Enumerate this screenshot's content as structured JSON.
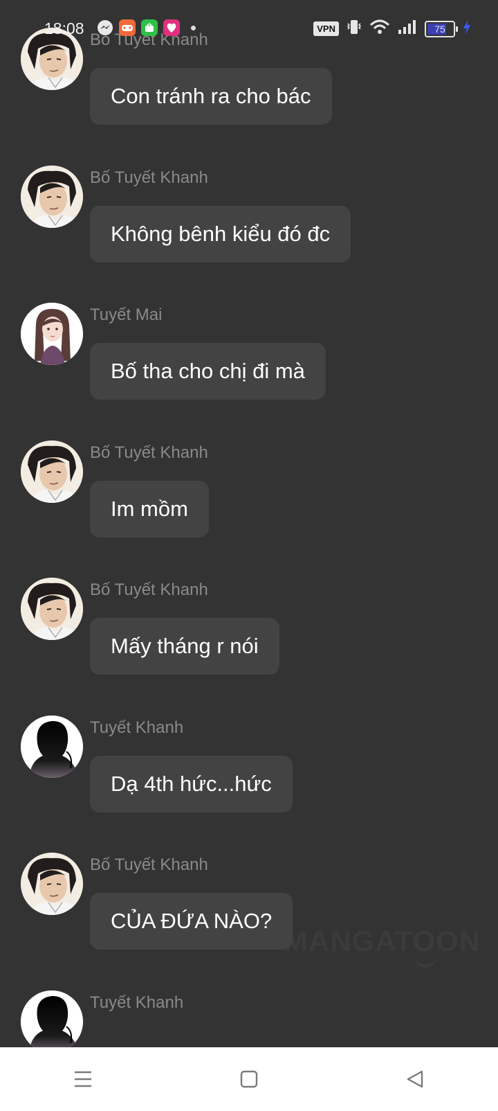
{
  "status_bar": {
    "time": "18:08",
    "vpn_label": "VPN",
    "battery_level": "75",
    "battery_fraction": 0.75,
    "icons": [
      "messenger-icon",
      "game-app-icon",
      "store-app-icon",
      "lite-app-icon",
      "vibrate-icon",
      "wifi-icon",
      "signal-icon",
      "charging-icon"
    ]
  },
  "messages": [
    {
      "sender": "Bố Tuyết Khanh",
      "text": "Con tránh ra cho bác",
      "avatar": "father-avatar"
    },
    {
      "sender": "Bố Tuyết Khanh",
      "text": "Không bênh kiểu đó đc",
      "avatar": "father-avatar"
    },
    {
      "sender": "Tuyết Mai",
      "text": "Bố tha cho chị đi mà",
      "avatar": "girl-avatar"
    },
    {
      "sender": "Bố Tuyết Khanh",
      "text": "Im mồm",
      "avatar": "father-avatar"
    },
    {
      "sender": "Bố Tuyết Khanh",
      "text": "Mấy tháng r nói",
      "avatar": "father-avatar"
    },
    {
      "sender": "Tuyết Khanh",
      "text": "Dạ 4th hức...hức",
      "avatar": "silhouette-avatar"
    },
    {
      "sender": "Bố Tuyết Khanh",
      "text": "CỦA ĐỨA NÀO?",
      "avatar": "father-avatar"
    },
    {
      "sender": "Tuyết Khanh",
      "text": "",
      "avatar": "silhouette-avatar"
    }
  ],
  "watermark": "MANGATOON",
  "nav_bar": {
    "buttons": [
      "menu-icon",
      "home-icon",
      "back-icon"
    ]
  },
  "colors": {
    "background": "#333333",
    "bubble": "#434343",
    "sender_text": "#8a8a8a",
    "message_text": "#ffffff",
    "battery_fill": "#3b3fb0",
    "charging": "#3b5bff"
  }
}
